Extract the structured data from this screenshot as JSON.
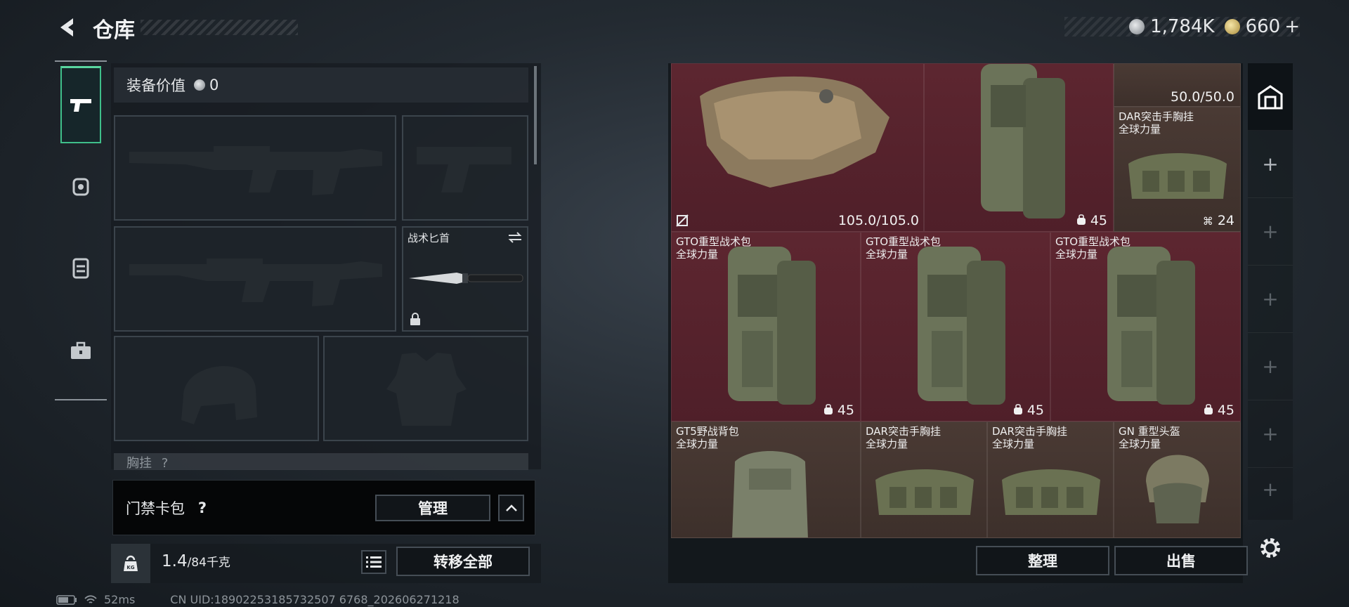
{
  "header": {
    "title": "仓库",
    "silver_amount": "1,784K",
    "gold_amount": "660",
    "gold_plus": "+"
  },
  "rail": {
    "items": [
      {
        "icon": "pistol-icon",
        "active": true
      },
      {
        "icon": "helmet-icon",
        "active": false
      },
      {
        "icon": "vest-icon",
        "active": false
      },
      {
        "icon": "toolbox-icon",
        "active": false
      }
    ]
  },
  "equipment": {
    "value_label": "装备价值",
    "value_amount": "0",
    "knife_label": "战术匕首",
    "chest_label": "胸挂",
    "chest_hint": "?"
  },
  "gate_pack": {
    "label": "门禁卡包",
    "help": "?",
    "manage": "管理"
  },
  "capacity": {
    "current": "1.4",
    "max": "/84千克",
    "transfer_all": "转移全部"
  },
  "storage": {
    "cells": [
      {
        "name": "",
        "value": "105.0/105.0"
      },
      {
        "name": "",
        "value": "45"
      },
      {
        "name": "",
        "value": "50.0/50.0"
      },
      {
        "name": "DAR突击手胸挂",
        "source": "全球力量",
        "value": "24"
      },
      {
        "name": "GTO重型战术包",
        "source": "全球力量",
        "value": "45"
      },
      {
        "name": "GTO重型战术包",
        "source": "全球力量",
        "value": "45"
      },
      {
        "name": "GTO重型战术包",
        "source": "全球力量",
        "value": "45"
      },
      {
        "name": "GT5野战背包",
        "source": "全球力量",
        "value": ""
      },
      {
        "name": "DAR突击手胸挂",
        "source": "全球力量",
        "value": ""
      },
      {
        "name": "DAR突击手胸挂",
        "source": "全球力量",
        "value": ""
      },
      {
        "name": "GN 重型头盔",
        "source": "全球力量",
        "value": ""
      }
    ],
    "sort": "整理",
    "sell": "出售"
  },
  "status": {
    "ping": "52ms",
    "uid": "CN UID:18902253185732507 6768_202606271218"
  },
  "colors": {
    "accent": "#3fbf8a",
    "cell_red": "#5d2630",
    "cell_brown": "#4a3a34"
  }
}
